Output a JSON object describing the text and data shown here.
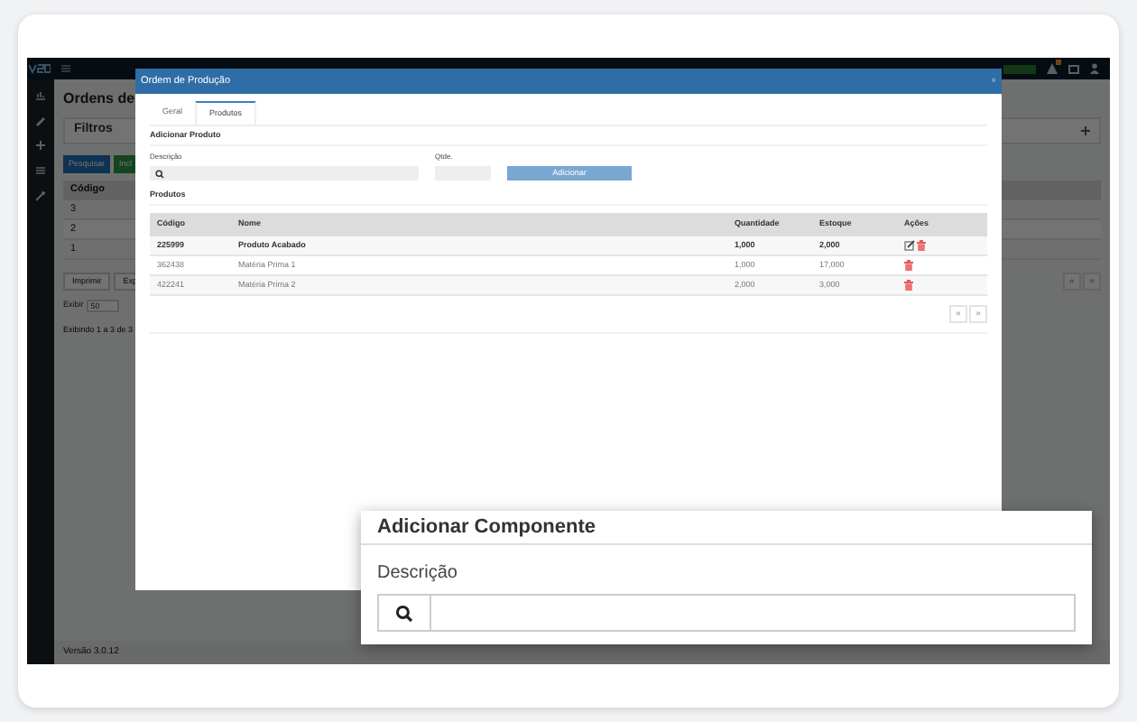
{
  "app": {
    "page_title": "Ordens de",
    "filters_title": "Filtros",
    "buttons": [
      {
        "label": "Pesquisar",
        "kind": "primary"
      },
      {
        "label": "Incl",
        "kind": "success"
      }
    ],
    "table": {
      "column": "Código",
      "rows": [
        "3",
        "2",
        "1"
      ]
    },
    "bottom_buttons": [
      "Imprimir",
      "Exp"
    ],
    "page_length": {
      "label": "Exibir",
      "value": "50"
    },
    "info": "Exibindo 1 a 3 de 3",
    "pager": [
      "«",
      "»"
    ],
    "version": "Versão 3.0.12"
  },
  "modal": {
    "title": "Ordem de Produção",
    "close": "×",
    "tabs": [
      {
        "label": "Geral",
        "selected": false
      },
      {
        "label": "Produtos",
        "selected": true
      }
    ],
    "section": "Adicionar Produto",
    "description_label": "Descrição",
    "qty_label": "Qtde.",
    "add_button": "Adicionar",
    "products_title": "Produtos",
    "columns": [
      "Código",
      "Nome",
      "Quantidade",
      "Estoque",
      "Ações"
    ],
    "rows": [
      {
        "code": "225999",
        "name": "Produto Acabado",
        "quantity": "1,000",
        "stock": "2,000",
        "bold": true,
        "editable": true
      },
      {
        "code": "362438",
        "name": "Matéria Prima 1",
        "quantity": "1,000",
        "stock": "17,000",
        "bold": false,
        "editable": false
      },
      {
        "code": "422241",
        "name": "Matéria Prima 2",
        "quantity": "2,000",
        "stock": "3,000",
        "bold": false,
        "editable": false
      }
    ],
    "pager": [
      "«",
      "»"
    ]
  },
  "callout": {
    "title": "Adicionar Componente",
    "description_label": "Descrição"
  }
}
